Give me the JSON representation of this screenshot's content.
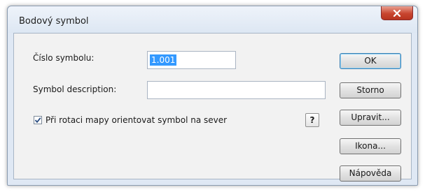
{
  "dialog": {
    "title": "Bodový symbol",
    "close_icon": "close-icon"
  },
  "form": {
    "symbol_number": {
      "label": "Číslo symbolu:",
      "value": "1.001"
    },
    "symbol_description": {
      "label": "Symbol description:",
      "value": ""
    },
    "north_orient": {
      "label": "Při rotaci mapy orientovat symbol na sever",
      "checked": true
    },
    "help_label": "?"
  },
  "buttons": {
    "ok": "OK",
    "cancel": "Storno",
    "edit": "Upravit...",
    "icon": "Ikona...",
    "help": "Nápověda"
  },
  "colors": {
    "selection": "#3399ff",
    "close_button": "#c8452f",
    "default_button_border": "#3c7fb1"
  }
}
